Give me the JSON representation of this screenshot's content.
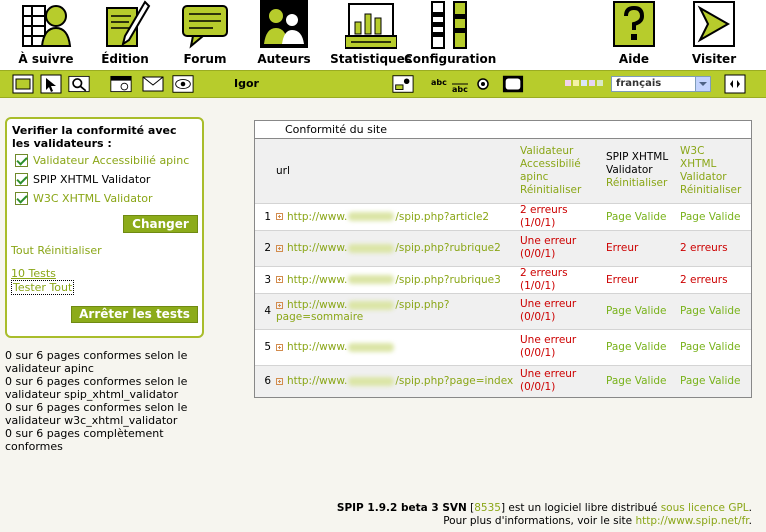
{
  "nav": [
    {
      "key": "home",
      "label": "À suivre",
      "icon": "home-icon"
    },
    {
      "key": "edit",
      "label": "Édition",
      "icon": "pen-icon"
    },
    {
      "key": "forum",
      "label": "Forum",
      "icon": "speech-bubble-icon"
    },
    {
      "key": "authors",
      "label": "Auteurs",
      "icon": "people-icon"
    },
    {
      "key": "stats",
      "label": "Statistiques",
      "icon": "statistics-icon"
    },
    {
      "key": "config",
      "label": "Configuration",
      "icon": "tools-icon"
    },
    {
      "key": "help",
      "label": "Aide",
      "icon": "help-icon"
    },
    {
      "key": "visit",
      "label": "Visiter",
      "icon": "visit-arrow-icon"
    }
  ],
  "toolbar": {
    "username": "Igor",
    "language": "français"
  },
  "validator_box": {
    "title": "Verifier la conformité avec les validateurs :",
    "validators": [
      {
        "label": "Validateur Accessibilié apinc",
        "color": "green"
      },
      {
        "label": "SPIP XHTML Validator",
        "color": "dark"
      },
      {
        "label": "W3C XHTML Validator",
        "color": "green"
      }
    ],
    "change_button": "Changer",
    "reset_all": "Tout Réinitialiser",
    "tests_count": "10 Tests",
    "test_all": "Tester Tout",
    "stop_button": "Arrêter les tests"
  },
  "summary": [
    "0 sur 6 pages conformes selon le validateur apinc",
    "0 sur 6 pages conformes selon le validateur spip_xhtml_validator",
    "0 sur 6 pages conformes selon le validateur w3c_xhtml_validator",
    "0 sur 6 pages complètement conformes"
  ],
  "results": {
    "title": "Conformité du site",
    "col_url": "url",
    "col_apinc": "Validateur Accessibilié apinc",
    "col_apinc_reset": "Réinitialiser",
    "col_spip_a": "SPIP XHTML",
    "col_spip_b": "Validator",
    "col_spip_reset": "Réinitialiser",
    "col_w3c": "W3C XHTML Validator",
    "col_w3c_reset": "Réinitialiser",
    "rows": [
      {
        "num": "1",
        "url_pre": "http://www.",
        "url_post": "/spip.php?article2",
        "apinc": "2 erreurs (1/0/1)",
        "apinc_status": "err",
        "spip": "Page Valide",
        "spip_status": "ok",
        "w3c": "Page Valide",
        "w3c_status": "ok"
      },
      {
        "num": "2",
        "url_pre": "http://www.",
        "url_post": "/spip.php?rubrique2",
        "apinc": "Une erreur (0/0/1)",
        "apinc_status": "err",
        "spip": "Erreur",
        "spip_status": "err",
        "w3c": "2 erreurs",
        "w3c_status": "err"
      },
      {
        "num": "3",
        "url_pre": "http://www.",
        "url_post": "/spip.php?rubrique3",
        "apinc": "2 erreurs (1/0/1)",
        "apinc_status": "err",
        "spip": "Erreur",
        "spip_status": "err",
        "w3c": "2 erreurs",
        "w3c_status": "err"
      },
      {
        "num": "4",
        "url_pre": "http://www.",
        "url_post": "/spip.php?page=sommaire",
        "apinc": "Une erreur (0/0/1)",
        "apinc_status": "err",
        "spip": "Page Valide",
        "spip_status": "ok",
        "w3c": "Page Valide",
        "w3c_status": "ok"
      },
      {
        "num": "5",
        "url_pre": "http://www.",
        "url_post": "",
        "apinc": "Une erreur (0/0/1)",
        "apinc_status": "err",
        "spip": "Page Valide",
        "spip_status": "ok",
        "w3c": "Page Valide",
        "w3c_status": "ok"
      },
      {
        "num": "6",
        "url_pre": "http://www.",
        "url_post": "/spip.php?page=index",
        "apinc": "Une erreur (0/0/1)",
        "apinc_status": "err",
        "spip": "Page Valide",
        "spip_status": "ok",
        "w3c": "Page Valide",
        "w3c_status": "ok"
      }
    ]
  },
  "footer": {
    "version": "SPIP 1.9.2 beta 3 SVN",
    "revision": "8535",
    "line1_mid": "est un logiciel libre distribué",
    "license": "sous licence GPL",
    "line2_pre": "Pour plus d'informations, voir le site",
    "site_url": "http://www.spip.net/fr"
  },
  "colors": {
    "accent": "#b7cc2c",
    "link": "#8aa617",
    "error": "#cc0000",
    "valid": "#78b21a"
  }
}
